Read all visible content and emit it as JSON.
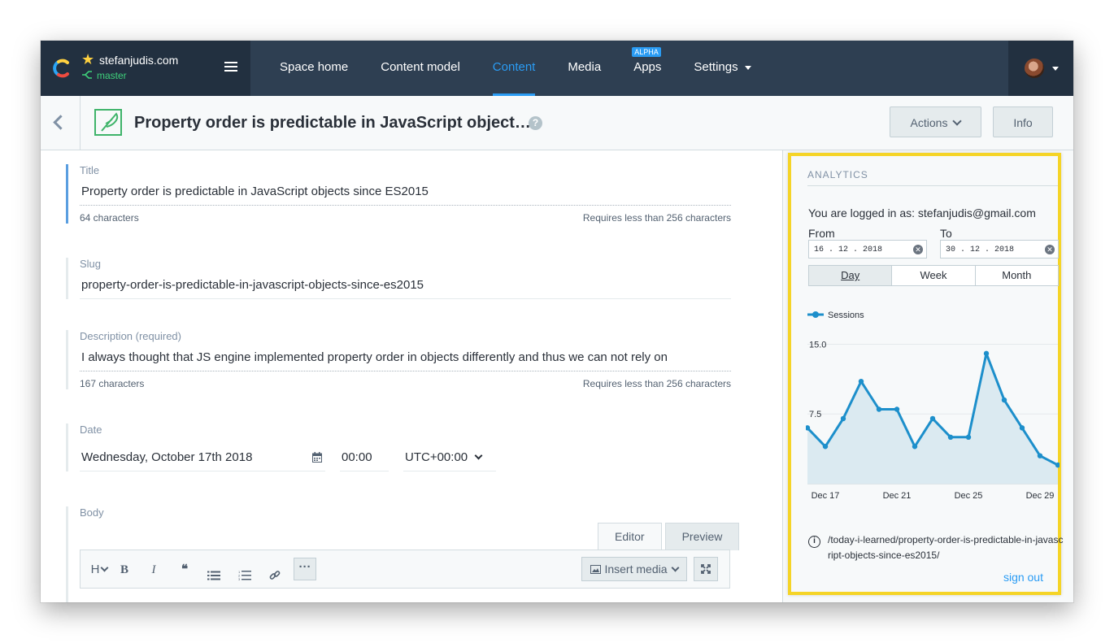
{
  "topbar": {
    "space_name": "stefanjudis.com",
    "environment": "master",
    "nav": [
      {
        "label": "Space home"
      },
      {
        "label": "Content model"
      },
      {
        "label": "Content",
        "active": true
      },
      {
        "label": "Media"
      },
      {
        "label": "Apps",
        "badge": "ALPHA"
      },
      {
        "label": "Settings",
        "dropdown": true
      }
    ]
  },
  "entry": {
    "title": "Property order is predictable in JavaScript object…",
    "help_glyph": "?",
    "actions_label": "Actions",
    "info_label": "Info"
  },
  "fields": {
    "title": {
      "label": "Title",
      "value": "Property order is predictable in JavaScript objects since ES2015",
      "count": "64 characters",
      "limit": "Requires less than 256 characters"
    },
    "slug": {
      "label": "Slug",
      "value": "property-order-is-predictable-in-javascript-objects-since-es2015"
    },
    "description": {
      "label": "Description (required)",
      "value": "I always thought that JS engine implemented property order in objects differently and thus we can not rely on",
      "count": "167 characters",
      "limit": "Requires less than 256 characters"
    },
    "date": {
      "label": "Date",
      "date_value": "Wednesday, October 17th 2018",
      "time_value": "00:00",
      "timezone": "UTC+00:00"
    },
    "body": {
      "label": "Body",
      "tab_editor": "Editor",
      "tab_preview": "Preview",
      "heading_btn": "H",
      "bold_btn": "B",
      "italic_btn": "I",
      "quote_btn": "❝",
      "insert_media": "Insert media"
    }
  },
  "analytics": {
    "heading": "ANALYTICS",
    "logged_in": "You are logged in as: stefanjudis@gmail.com",
    "from_label": "From",
    "to_label": "To",
    "from_value": "16 . 12 . 2018",
    "to_value": "30 . 12 . 2018",
    "range_options": [
      "Day",
      "Week",
      "Month"
    ],
    "range_selected": "Day",
    "path": "/today-i-learned/property-order-is-predictable-in-javascript-objects-since-es2015/",
    "signout": "sign out"
  },
  "chart_data": {
    "type": "area",
    "series": [
      {
        "name": "Sessions",
        "values": [
          6,
          4,
          7,
          11,
          8,
          8,
          4,
          7,
          5,
          5,
          14,
          9,
          6,
          3,
          2
        ]
      }
    ],
    "x": [
      "Dec 16",
      "Dec 17",
      "Dec 18",
      "Dec 19",
      "Dec 20",
      "Dec 21",
      "Dec 22",
      "Dec 23",
      "Dec 24",
      "Dec 25",
      "Dec 26",
      "Dec 27",
      "Dec 28",
      "Dec 29",
      "Dec 30"
    ],
    "x_tick_labels": [
      "Dec 17",
      "Dec 21",
      "Dec 25",
      "Dec 29"
    ],
    "y_tick_labels": [
      "15.0",
      "7.5"
    ],
    "ylim": [
      0,
      16
    ],
    "grid": true,
    "legend": "top-left",
    "colors": {
      "line": "#1d8fcb",
      "fill": "#dbeaf1"
    }
  }
}
